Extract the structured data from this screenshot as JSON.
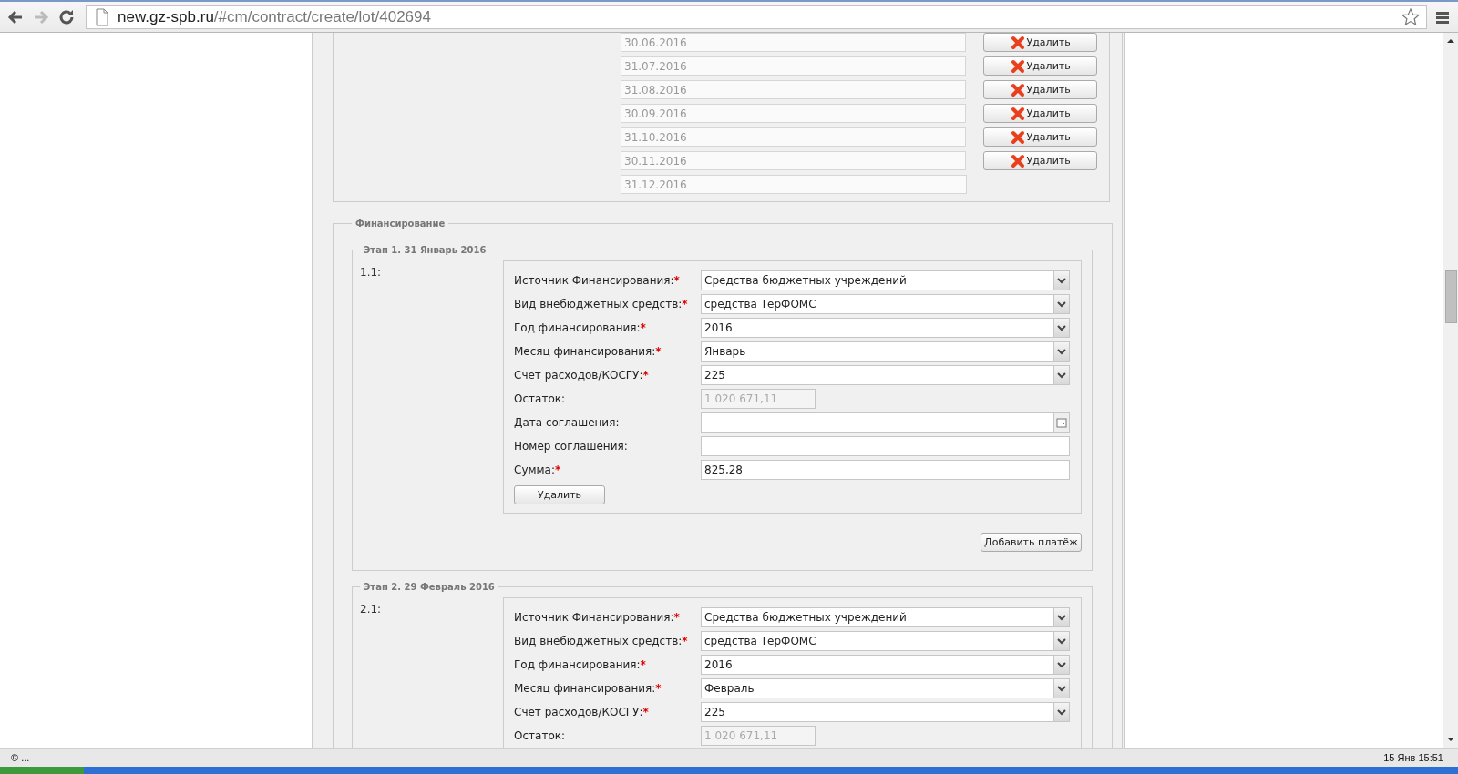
{
  "browser": {
    "url_host": "new.gz-spb.ru",
    "url_path": "/#cm/contract/create/lot/402694"
  },
  "required_mark": "*",
  "dates": [
    {
      "value": "30.06.2016",
      "disabled": true,
      "delete_button": "Удалить"
    },
    {
      "value": "31.07.2016",
      "disabled": true,
      "delete_button": "Удалить"
    },
    {
      "value": "31.08.2016",
      "disabled": true,
      "delete_button": "Удалить"
    },
    {
      "value": "30.09.2016",
      "disabled": true,
      "delete_button": "Удалить"
    },
    {
      "value": "31.10.2016",
      "disabled": true,
      "delete_button": "Удалить"
    },
    {
      "value": "30.11.2016",
      "disabled": true,
      "delete_button": "Удалить"
    },
    {
      "value": "31.12.2016",
      "disabled": true
    }
  ],
  "financing": {
    "legend": "Финансирование",
    "stages": [
      {
        "legend": "Этап 1. 31 Январь 2016",
        "payments": [
          {
            "number": "1.1:",
            "fields": [
              {
                "kind": "select",
                "label": "Источник Финансирования:",
                "required": true,
                "value": "Средства бюджетных учреждений"
              },
              {
                "kind": "select",
                "label": "Вид внебюджетных средств:",
                "required": true,
                "value": "средства ТерФОМС"
              },
              {
                "kind": "select",
                "label": "Год финансирования:",
                "required": true,
                "value": "2016"
              },
              {
                "kind": "select",
                "label": "Месяц финансирования:",
                "required": true,
                "value": "Январь"
              },
              {
                "kind": "select",
                "label": "Счет расходов/КОСГУ:",
                "required": true,
                "value": "225"
              },
              {
                "kind": "readonly",
                "label": "Остаток:",
                "required": false,
                "value": "1 020 671,11"
              },
              {
                "kind": "date",
                "label": "Дата соглашения:",
                "required": false
              },
              {
                "kind": "text",
                "label": "Номер соглашения:",
                "required": false
              },
              {
                "kind": "text",
                "label": "Сумма:",
                "required": true,
                "value": "825,28"
              }
            ],
            "delete_button": "Удалить"
          }
        ],
        "add_button": "Добавить платёж"
      },
      {
        "legend": "Этап 2. 29 Февраль 2016",
        "payments": [
          {
            "number": "2.1:",
            "fields": [
              {
                "kind": "select",
                "label": "Источник Финансирования:",
                "required": true,
                "value": "Средства бюджетных учреждений"
              },
              {
                "kind": "select",
                "label": "Вид внебюджетных средств:",
                "required": true,
                "value": "средства ТерФОМС"
              },
              {
                "kind": "select",
                "label": "Год финансирования:",
                "required": true,
                "value": "2016"
              },
              {
                "kind": "select",
                "label": "Месяц финансирования:",
                "required": true,
                "value": "Февраль"
              },
              {
                "kind": "select",
                "label": "Счет расходов/КОСГУ:",
                "required": true,
                "value": "225"
              },
              {
                "kind": "readonly",
                "label": "Остаток:",
                "required": false,
                "value": "1 020 671,11"
              }
            ]
          }
        ]
      }
    ]
  },
  "status_bar": {
    "left": "© ...",
    "right": "15 Янв 15:51"
  }
}
